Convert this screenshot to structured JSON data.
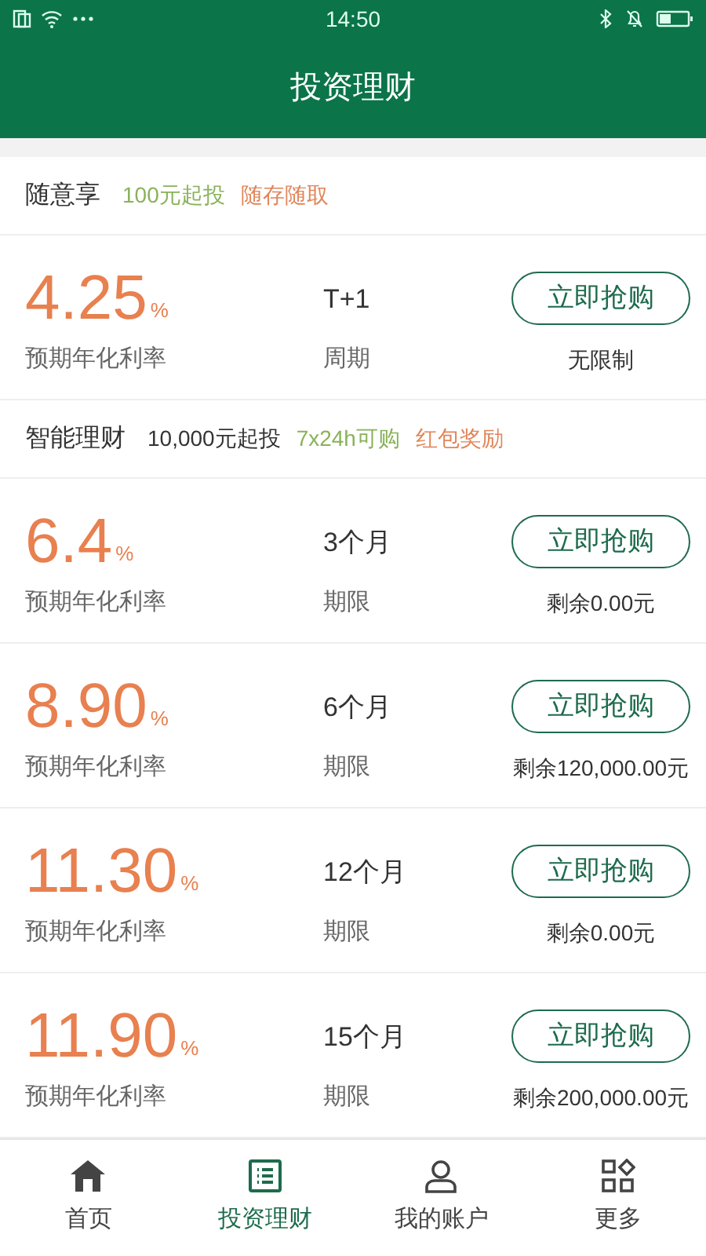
{
  "status_bar": {
    "time": "14:50"
  },
  "header": {
    "title": "投资理财"
  },
  "sections": [
    {
      "title": "随意享",
      "tags": [
        {
          "text": "100元起投",
          "color": "#8ab25a"
        },
        {
          "text": "随存随取",
          "color": "#e0865a"
        }
      ],
      "products": [
        {
          "rate": "4.25",
          "unit": "%",
          "rate_label": "预期年化利率",
          "term": "T+1",
          "term_label": "周期",
          "button": "立即抢购",
          "remaining": "无限制"
        }
      ]
    },
    {
      "title": "智能理财",
      "tags": [
        {
          "text": "10,000元起投",
          "color": "#333333"
        },
        {
          "text": "7x24h可购",
          "color": "#8ab25a"
        },
        {
          "text": "红包奖励",
          "color": "#e0865a"
        }
      ],
      "products": [
        {
          "rate": "6.4",
          "unit": "%",
          "rate_label": "预期年化利率",
          "term": "3个月",
          "term_label": "期限",
          "button": "立即抢购",
          "remaining": "剩余0.00元"
        },
        {
          "rate": "8.90",
          "unit": "%",
          "rate_label": "预期年化利率",
          "term": "6个月",
          "term_label": "期限",
          "button": "立即抢购",
          "remaining": "剩余120,000.00元"
        },
        {
          "rate": "11.30",
          "unit": "%",
          "rate_label": "预期年化利率",
          "term": "12个月",
          "term_label": "期限",
          "button": "立即抢购",
          "remaining": "剩余0.00元"
        },
        {
          "rate": "11.90",
          "unit": "%",
          "rate_label": "预期年化利率",
          "term": "15个月",
          "term_label": "期限",
          "button": "立即抢购",
          "remaining": "剩余200,000.00元"
        }
      ]
    }
  ],
  "tabs": [
    {
      "kind": "home",
      "label": "首页",
      "selected": false
    },
    {
      "kind": "list",
      "label": "投资理财",
      "selected": true
    },
    {
      "kind": "account",
      "label": "我的账户",
      "selected": false
    },
    {
      "kind": "more",
      "label": "更多",
      "selected": false
    }
  ]
}
